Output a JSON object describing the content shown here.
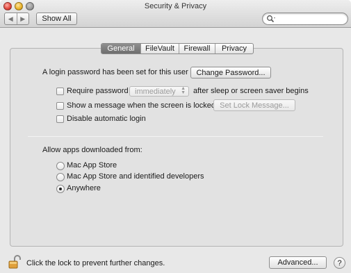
{
  "window": {
    "title": "Security & Privacy"
  },
  "toolbar": {
    "back_glyph": "◀",
    "forward_glyph": "▶",
    "show_all_label": "Show All",
    "search_placeholder": "",
    "search_icon": "magnifier-icon"
  },
  "tabs": [
    {
      "label": "General",
      "active": true
    },
    {
      "label": "FileVault",
      "active": false
    },
    {
      "label": "Firewall",
      "active": false
    },
    {
      "label": "Privacy",
      "active": false
    }
  ],
  "general": {
    "login_password_text": "A login password has been set for this user",
    "change_password_label": "Change Password...",
    "require_password": {
      "label": "Require password",
      "checked": false,
      "delay_value": "immediately",
      "suffix": "after sleep or screen saver begins"
    },
    "show_message": {
      "label": "Show a message when the screen is locked",
      "checked": false,
      "button_label": "Set Lock Message..."
    },
    "disable_auto_login": {
      "label": "Disable automatic login",
      "checked": false
    },
    "allow_apps_heading": "Allow apps downloaded from:",
    "allow_apps_options": [
      {
        "label": "Mac App Store",
        "selected": false
      },
      {
        "label": "Mac App Store and identified developers",
        "selected": false
      },
      {
        "label": "Anywhere",
        "selected": true
      }
    ]
  },
  "footer": {
    "lock_text": "Click the lock to prevent further changes.",
    "advanced_label": "Advanced...",
    "help_label": "?"
  },
  "colors": {
    "window_bg": "#e8e8e8",
    "panel_bg": "#e2e2e2",
    "active_tab": "#7a7a7a",
    "lock_gold": "#e0a03a"
  }
}
